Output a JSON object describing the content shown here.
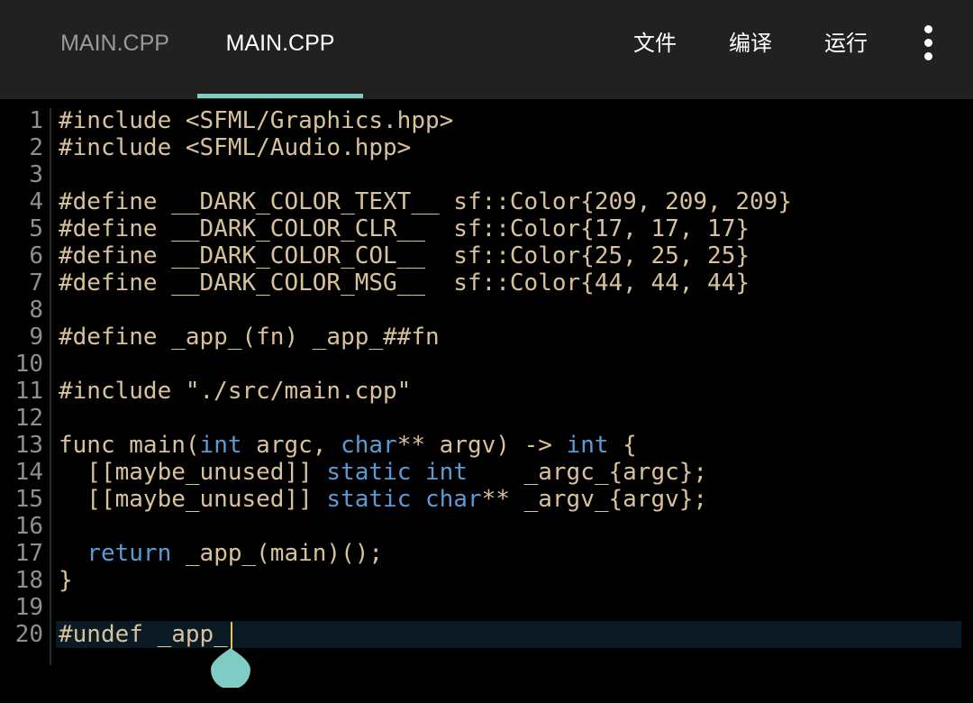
{
  "tabs": [
    {
      "label": "MAIN.CPP",
      "active": false
    },
    {
      "label": "MAIN.CPP",
      "active": true
    }
  ],
  "menu": {
    "file_label": "文件",
    "compile_label": "编译",
    "run_label": "运行",
    "overflow_icon": "more-vert-icon"
  },
  "colors": {
    "accent": "#80cbc4",
    "keyword": "#5b9bd5",
    "text": "#d8c29b",
    "caret": "#e8c547"
  },
  "editor": {
    "active_line": 20,
    "lines": [
      {
        "n": "1",
        "segments": [
          {
            "t": "#include <SFML/Graphics.hpp>"
          }
        ]
      },
      {
        "n": "2",
        "segments": [
          {
            "t": "#include <SFML/Audio.hpp>"
          }
        ]
      },
      {
        "n": "3",
        "segments": []
      },
      {
        "n": "4",
        "segments": [
          {
            "t": "#define __DARK_COLOR_TEXT__ sf::Color{209, 209, 209}"
          }
        ]
      },
      {
        "n": "5",
        "segments": [
          {
            "t": "#define __DARK_COLOR_CLR__  sf::Color{17, 17, 17}"
          }
        ]
      },
      {
        "n": "6",
        "segments": [
          {
            "t": "#define __DARK_COLOR_COL__  sf::Color{25, 25, 25}"
          }
        ]
      },
      {
        "n": "7",
        "segments": [
          {
            "t": "#define __DARK_COLOR_MSG__  sf::Color{44, 44, 44}"
          }
        ]
      },
      {
        "n": "8",
        "segments": []
      },
      {
        "n": "9",
        "segments": [
          {
            "t": "#define _app_(fn) _app_##fn"
          }
        ]
      },
      {
        "n": "10",
        "segments": []
      },
      {
        "n": "11",
        "segments": [
          {
            "t": "#include \"./src/main.cpp\""
          }
        ]
      },
      {
        "n": "12",
        "segments": []
      },
      {
        "n": "13",
        "segments": [
          {
            "t": "func main("
          },
          {
            "t": "int",
            "kw": true
          },
          {
            "t": " argc, "
          },
          {
            "t": "char",
            "kw": true
          },
          {
            "t": "** argv) -> "
          },
          {
            "t": "int",
            "kw": true
          },
          {
            "t": " {"
          }
        ]
      },
      {
        "n": "14",
        "segments": [
          {
            "t": "  [[maybe_unused]] "
          },
          {
            "t": "static",
            "kw": true
          },
          {
            "t": " "
          },
          {
            "t": "int",
            "kw": true
          },
          {
            "t": "    _argc_{argc};"
          }
        ]
      },
      {
        "n": "15",
        "segments": [
          {
            "t": "  [[maybe_unused]] "
          },
          {
            "t": "static",
            "kw": true
          },
          {
            "t": " "
          },
          {
            "t": "char",
            "kw": true
          },
          {
            "t": "** _argv_{argv};"
          }
        ]
      },
      {
        "n": "16",
        "segments": []
      },
      {
        "n": "17",
        "segments": [
          {
            "t": "  "
          },
          {
            "t": "return",
            "kw": true
          },
          {
            "t": " _app_(main)();"
          }
        ]
      },
      {
        "n": "18",
        "segments": [
          {
            "t": "}"
          }
        ]
      },
      {
        "n": "19",
        "segments": []
      },
      {
        "n": "20",
        "segments": [
          {
            "t": "#undef _app_"
          }
        ]
      }
    ]
  }
}
